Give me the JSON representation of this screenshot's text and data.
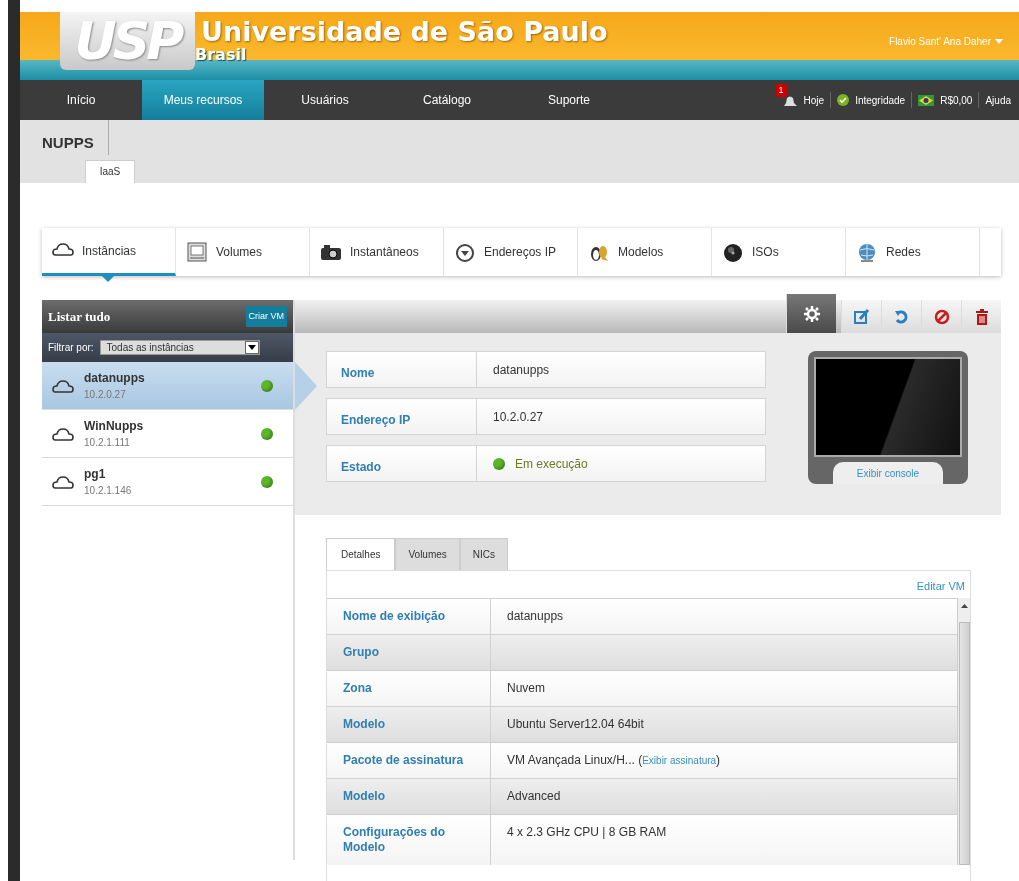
{
  "header": {
    "logo": "USP",
    "title": "Universidade de São Paulo",
    "subtitle": "Brasil",
    "user": "Flavio  Sant' Ana Daher"
  },
  "nav": [
    {
      "label": "Início",
      "selected": false
    },
    {
      "label": "Meus recursos",
      "selected": true
    },
    {
      "label": "Usuários",
      "selected": false
    },
    {
      "label": "Catálogo",
      "selected": false
    },
    {
      "label": "Suporte",
      "selected": false
    }
  ],
  "status": {
    "notifications": "1",
    "today": "Hoje",
    "integrity": "Integridade",
    "balance": "R$0,00",
    "help": "Ajuda"
  },
  "project": {
    "name": "NUPPS",
    "tabs": [
      {
        "label": "IaaS"
      }
    ]
  },
  "sections": [
    {
      "label": "Instâncias",
      "kind": "cloud",
      "selected": true
    },
    {
      "label": "Volumes",
      "kind": "disk",
      "selected": false
    },
    {
      "label": "Instantâneos",
      "kind": "camera",
      "selected": false
    },
    {
      "label": "Endereços IP",
      "kind": "ip",
      "selected": false
    },
    {
      "label": "Modelos",
      "kind": "penguin",
      "selected": false
    },
    {
      "label": "ISOs",
      "kind": "cd",
      "selected": false
    },
    {
      "label": "Redes",
      "kind": "globe",
      "selected": false
    }
  ],
  "list": {
    "title": "Listar tudo",
    "create": "Criar VM",
    "filter_label": "Filtrar por:",
    "filter_value": "Todas as instâncias",
    "items": [
      {
        "name": "datanupps",
        "ip": "10.2.0.27",
        "selected": true,
        "color": "#5cb82a"
      },
      {
        "name": "WinNupps",
        "ip": "10.2.1.111",
        "selected": false,
        "color": "#5cb82a"
      },
      {
        "name": "pg1",
        "ip": "10.2.1.146",
        "selected": false,
        "color": "#5cb82a"
      }
    ]
  },
  "actions": [
    {
      "kind": "settings",
      "selected": true
    },
    {
      "kind": "edit",
      "selected": false
    },
    {
      "kind": "restart",
      "selected": false
    },
    {
      "kind": "stop",
      "selected": false
    },
    {
      "kind": "delete",
      "selected": false
    }
  ],
  "summary": [
    {
      "label": "Nome",
      "value": "datanupps"
    },
    {
      "label": "Endereço IP",
      "value": "10.2.0.27"
    },
    {
      "label": "Estado",
      "value": "Em execução",
      "color": "#5cb82a"
    }
  ],
  "console": {
    "label": "Exibir console"
  },
  "detail_tabs": [
    {
      "label": "Detalhes",
      "selected": true
    },
    {
      "label": "Volumes",
      "selected": false
    },
    {
      "label": "NICs",
      "selected": false
    }
  ],
  "edit_link": "Editar VM",
  "details": [
    {
      "label": "Nome de exibição",
      "value": "datanupps"
    },
    {
      "label": "Grupo"
    },
    {
      "label": "Zona",
      "value": "Nuvem"
    },
    {
      "label": "Modelo",
      "value": "Ubuntu Server12.04 64bit"
    },
    {
      "label": "Pacote de assinatura",
      "value": "VM Avançada Linux/H... (",
      "link": "Exibir assinatura",
      "after": ")"
    },
    {
      "label": "Modelo",
      "value": "Advanced"
    },
    {
      "label": "Configurações do Modelo",
      "value": "4 x 2.3 GHz CPU | 8 GB RAM"
    }
  ]
}
